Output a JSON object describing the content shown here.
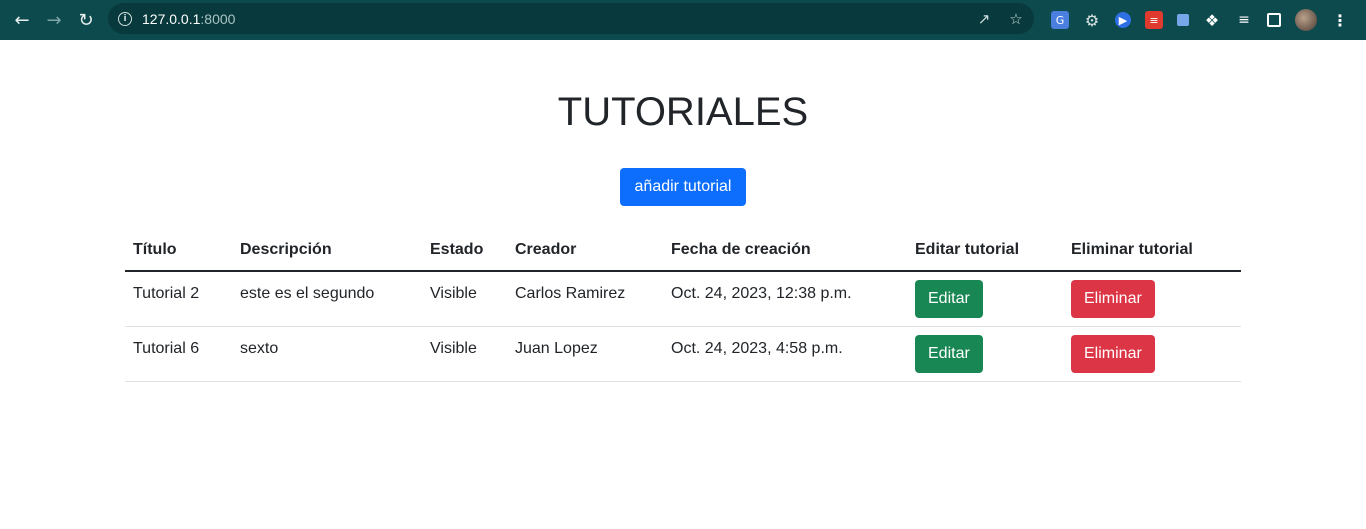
{
  "browser": {
    "url_host": "127.0.0.1",
    "url_port": ":8000",
    "back_icon": "arrow-left-icon",
    "forward_icon": "arrow-right-icon",
    "reload_icon": "reload-icon"
  },
  "page": {
    "title": "TUTORIALES",
    "add_button_label": "añadir tutorial"
  },
  "table": {
    "headers": [
      "Título",
      "Descripción",
      "Estado",
      "Creador",
      "Fecha de creación",
      "Editar tutorial",
      "Eliminar tutorial"
    ],
    "rows": [
      {
        "titulo": "Tutorial 2",
        "descripcion": "este es el segundo",
        "estado": "Visible",
        "creador": "Carlos Ramirez",
        "fecha": "Oct. 24, 2023, 12:38 p.m.",
        "edit_label": "Editar",
        "delete_label": "Eliminar"
      },
      {
        "titulo": "Tutorial 6",
        "descripcion": "sexto",
        "estado": "Visible",
        "creador": "Juan Lopez",
        "fecha": "Oct. 24, 2023, 4:58 p.m.",
        "edit_label": "Editar",
        "delete_label": "Eliminar"
      }
    ]
  },
  "colors": {
    "primary": "#0d6efd",
    "success": "#198754",
    "danger": "#dc3545",
    "browser_bar": "#0c4a4e"
  }
}
